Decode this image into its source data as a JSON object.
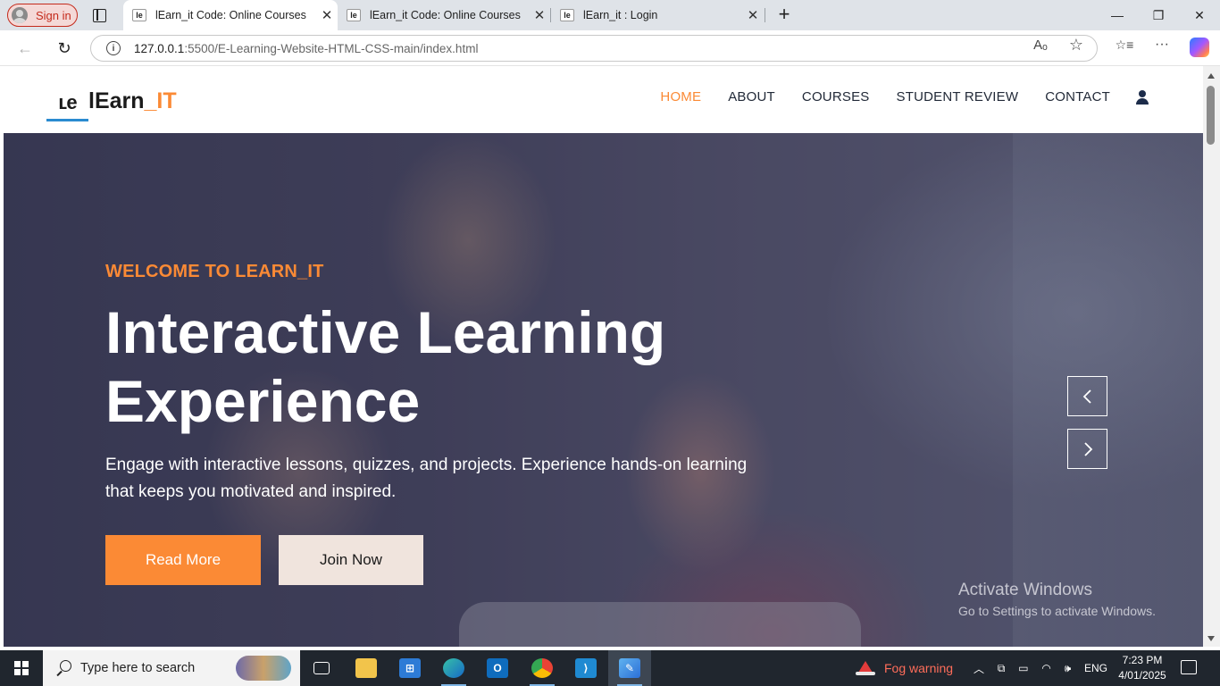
{
  "browser": {
    "sign_in_label": "Sign in",
    "tabs": [
      {
        "title": "lEarn_it Code: Online Courses",
        "favicon": "le",
        "active": true
      },
      {
        "title": "lEarn_it Code: Online Courses",
        "favicon": "le",
        "active": false
      },
      {
        "title": "lEarn_it : Login",
        "favicon": "le",
        "active": false
      }
    ],
    "tab_close_glyph": "✕",
    "new_tab_glyph": "+",
    "window_controls": {
      "minimize": "—",
      "maximize": "❐",
      "close": "✕"
    },
    "url_host": "127.0.0.1",
    "url_rest": ":5500/E-Learning-Website-HTML-CSS-main/index.html",
    "nav": {
      "back": "←",
      "reload": "↻"
    },
    "toolbar": {
      "read_aloud": "Aₒ",
      "favorite": "☆",
      "favorites_list": "☆≡",
      "more": "···"
    }
  },
  "site": {
    "logo_mark": "ʟe",
    "logo_name_prefix": "lEarn",
    "logo_name_accent": "_IT",
    "menu": [
      {
        "label": "HOME",
        "active": true
      },
      {
        "label": "ABOUT",
        "active": false
      },
      {
        "label": "COURSES",
        "active": false
      },
      {
        "label": "STUDENT REVIEW",
        "active": false
      },
      {
        "label": "CONTACT",
        "active": false
      }
    ],
    "accent_color": "#fb8a35"
  },
  "hero": {
    "kicker": "WELCOME TO LEARN_IT",
    "headline": "Interactive Learning Experience",
    "lead": "Engage with interactive lessons, quizzes, and projects. Experience hands-on learning that keeps you motivated and inspired.",
    "primary_button": "Read More",
    "secondary_button": "Join Now",
    "watermark_title": "Activate Windows",
    "watermark_sub": "Go to Settings to activate Windows."
  },
  "taskbar": {
    "search_placeholder": "Type here to search",
    "weather": "Fog warning",
    "language": "ENG",
    "time": "7:23 PM",
    "date": "4/01/2025",
    "apps": [
      "task-view",
      "file-explorer",
      "microsoft-store",
      "edge",
      "outlook",
      "chrome",
      "vscode",
      "paint"
    ]
  }
}
